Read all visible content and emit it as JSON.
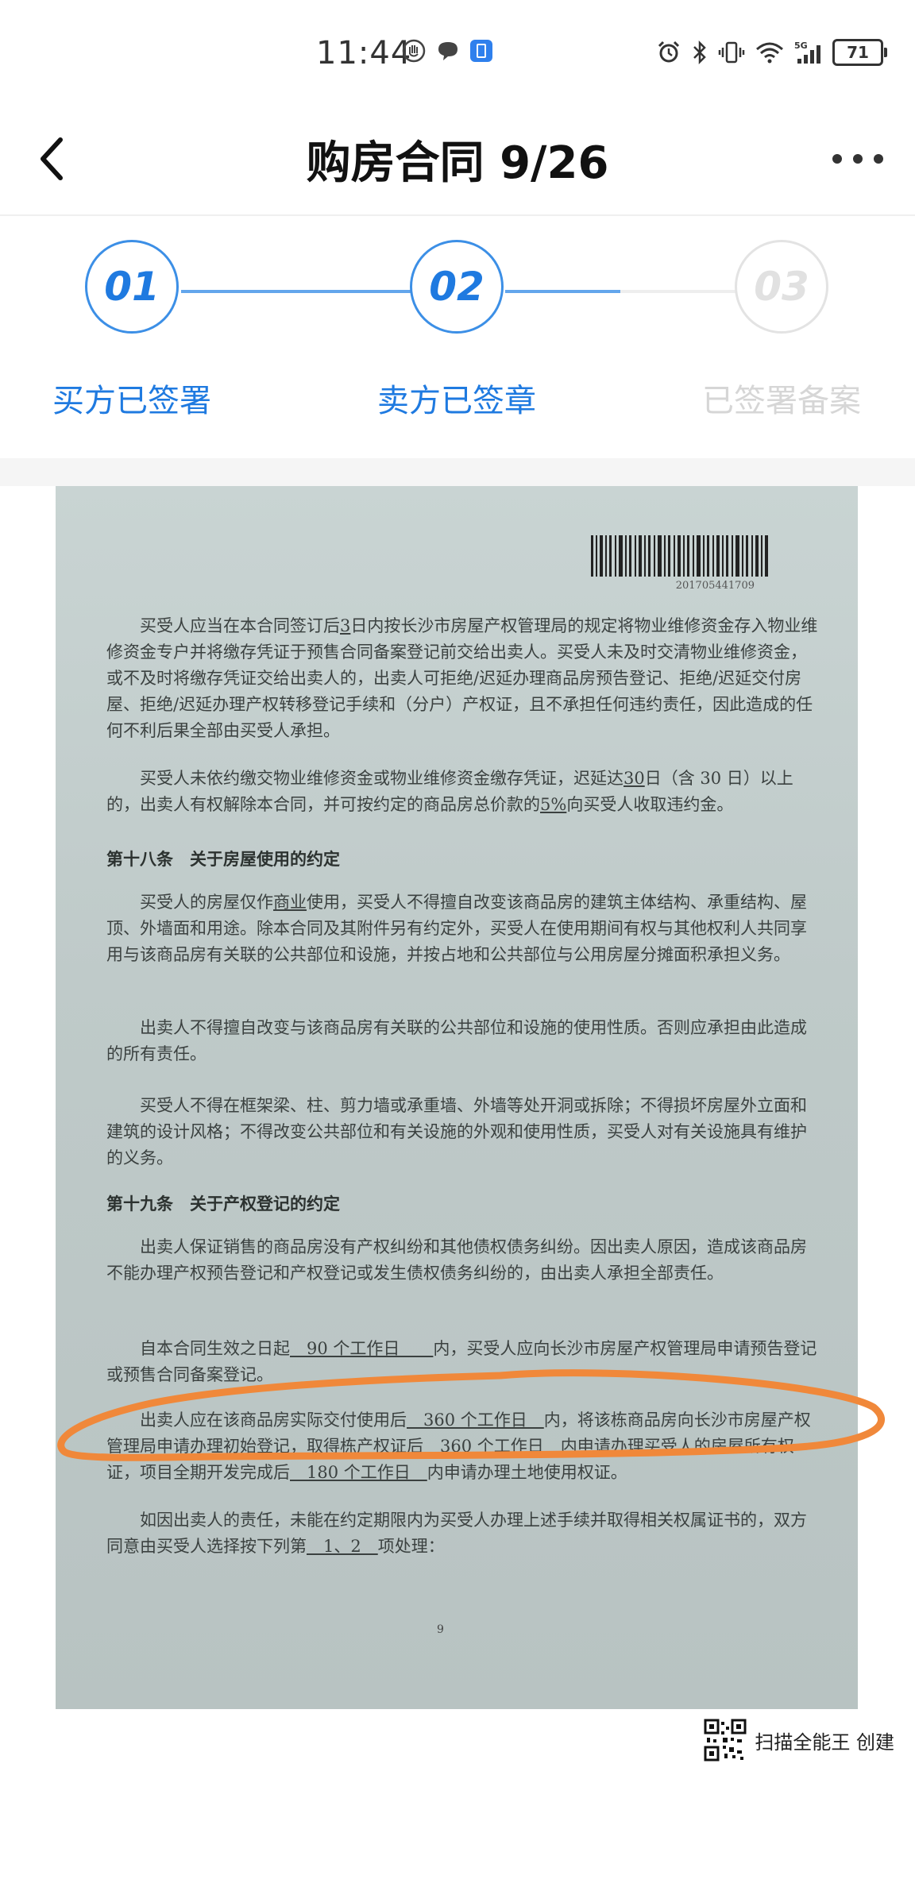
{
  "status_bar": {
    "time": "11:44",
    "battery": "71",
    "network": "5G"
  },
  "header": {
    "title": "购房合同 9/26"
  },
  "steps": [
    {
      "num": "01",
      "label": "买方已签署",
      "done": true
    },
    {
      "num": "02",
      "label": "卖方已签章",
      "done": true
    },
    {
      "num": "03",
      "label": "已签署备案",
      "done": false
    }
  ],
  "document": {
    "barcode_number": "201705441709",
    "p1": {
      "a": "买受人应当在本合同签订后",
      "b": "3",
      "c": "日内按长沙市房屋产权管理局的规定将物业维修资金存入物业维修资金专户并将缴存凭证于预售合同备案登记前交给出卖人。买受人未及时交清物业维修资金，或不及时将缴存凭证交给出卖人的，出卖人可拒绝/迟延办理商品房预告登记、拒绝/迟延交付房屋、拒绝/迟延办理产权转移登记手续和（分户）产权证，且不承担任何违约责任，因此造成的任何不利后果全部由买受人承担。"
    },
    "p2": {
      "a": "买受人未依约缴交物业维修资金或物业维修资金缴存凭证，迟延达",
      "b": "30",
      "c": "日（含 30 日）以上的，出卖人有权解除本合同，并可按约定的商品房总价款的",
      "d": "5%",
      "e": "向买受人收取违约金。"
    },
    "h18": "第十八条　关于房屋使用的约定",
    "p3": {
      "a": "买受人的房屋仅作",
      "b": "商业",
      "c": "使用，买受人不得擅自改变该商品房的建筑主体结构、承重结构、屋顶、外墙面和用途。除本合同及其附件另有约定外，买受人在使用期间有权与其他权利人共同享用与该商品房有关联的公共部位和设施，并按占地和公共部位与公用房屋分摊面积承担义务。"
    },
    "p4": "出卖人不得擅自改变与该商品房有关联的公共部位和设施的使用性质。否则应承担由此造成的所有责任。",
    "p5": "买受人不得在框架梁、柱、剪力墙或承重墙、外墙等处开洞或拆除；不得损坏房屋外立面和建筑的设计风格；不得改变公共部位和有关设施的外观和使用性质，买受人对有关设施具有维护的义务。",
    "h19": "第十九条　关于产权登记的约定",
    "p6": "出卖人保证销售的商品房没有产权纠纷和其他债权债务纠纷。因出卖人原因，造成该商品房不能办理产权预告登记和产权登记或发生债权债务纠纷的，由出卖人承担全部责任。",
    "p7": {
      "a": "自本合同生效之日起",
      "b": "　90 个工作日　　",
      "c": "内，买受人应向长沙市房屋产权管理局申请预告登记或预售合同备案登记。"
    },
    "p8": {
      "a": "出卖人应在该商品房实际交付使用后",
      "b": "　360 个工作日　",
      "c": "内，将该栋商品房向长沙市房屋产权管理局申请办理初始登记，取得栋产权证后",
      "d": "　360 个工作日　",
      "e": "内申请办理买受人的房屋所有权证，项目全期开发完成后",
      "f": "　180 个工作日　",
      "g": "内申请办理土地使用权证。"
    },
    "p9": {
      "a": "如因出卖人的责任，未能在约定期限内为买受人办理上述手续并取得相关权属证书的，双方同意由买受人选择按下列第",
      "b": "　1、2　",
      "c": "项处理："
    },
    "page_number": "9",
    "highlight_color": "#f0883a"
  },
  "watermark": {
    "text": "扫描全能王 创建"
  },
  "colors": {
    "accent": "#1f7ae0",
    "inactive": "#d6d6d6"
  }
}
